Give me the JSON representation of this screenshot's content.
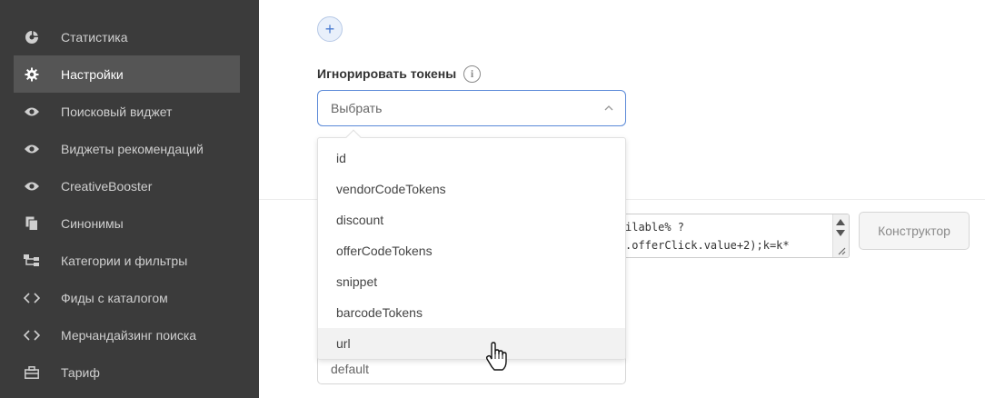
{
  "sidebar": {
    "items": [
      {
        "label": "Статистика",
        "icon": "chart-pie-icon",
        "active": false
      },
      {
        "label": "Настройки",
        "icon": "gear-icon",
        "active": true
      },
      {
        "label": "Поисковый виджет",
        "icon": "eye-icon",
        "active": false
      },
      {
        "label": "Виджеты рекомендаций",
        "icon": "eye-icon",
        "active": false
      },
      {
        "label": "CreativeBooster",
        "icon": "eye-icon",
        "active": false
      },
      {
        "label": "Синонимы",
        "icon": "copy-icon",
        "active": false
      },
      {
        "label": "Категории и фильтры",
        "icon": "tree-icon",
        "active": false
      },
      {
        "label": "Фиды с каталогом",
        "icon": "code-icon",
        "active": false
      },
      {
        "label": "Мерчандайзинг поиска",
        "icon": "code-icon",
        "active": false
      },
      {
        "label": "Тариф",
        "icon": "briefcase-icon",
        "active": false
      }
    ]
  },
  "main": {
    "add_button_label": "+",
    "ignore_tokens_label": "Игнорировать токены",
    "info_icon_label": "i",
    "select_placeholder": "Выбрать",
    "dropdown_options": [
      "id",
      "vendorCodeTokens",
      "discount",
      "offerCodeTokens",
      "snippet",
      "barcodeTokens",
      "url"
    ],
    "hovered_option": "url",
    "code_lines": [
      "ilable% ?",
      ".offerClick.value+2);k=k*"
    ],
    "constructor_button": "Конструктор",
    "lower_select_value": "default"
  },
  "colors": {
    "sidebar_bg": "#3b3b3b",
    "sidebar_active_bg": "#555555",
    "accent": "#5b8ad8"
  }
}
